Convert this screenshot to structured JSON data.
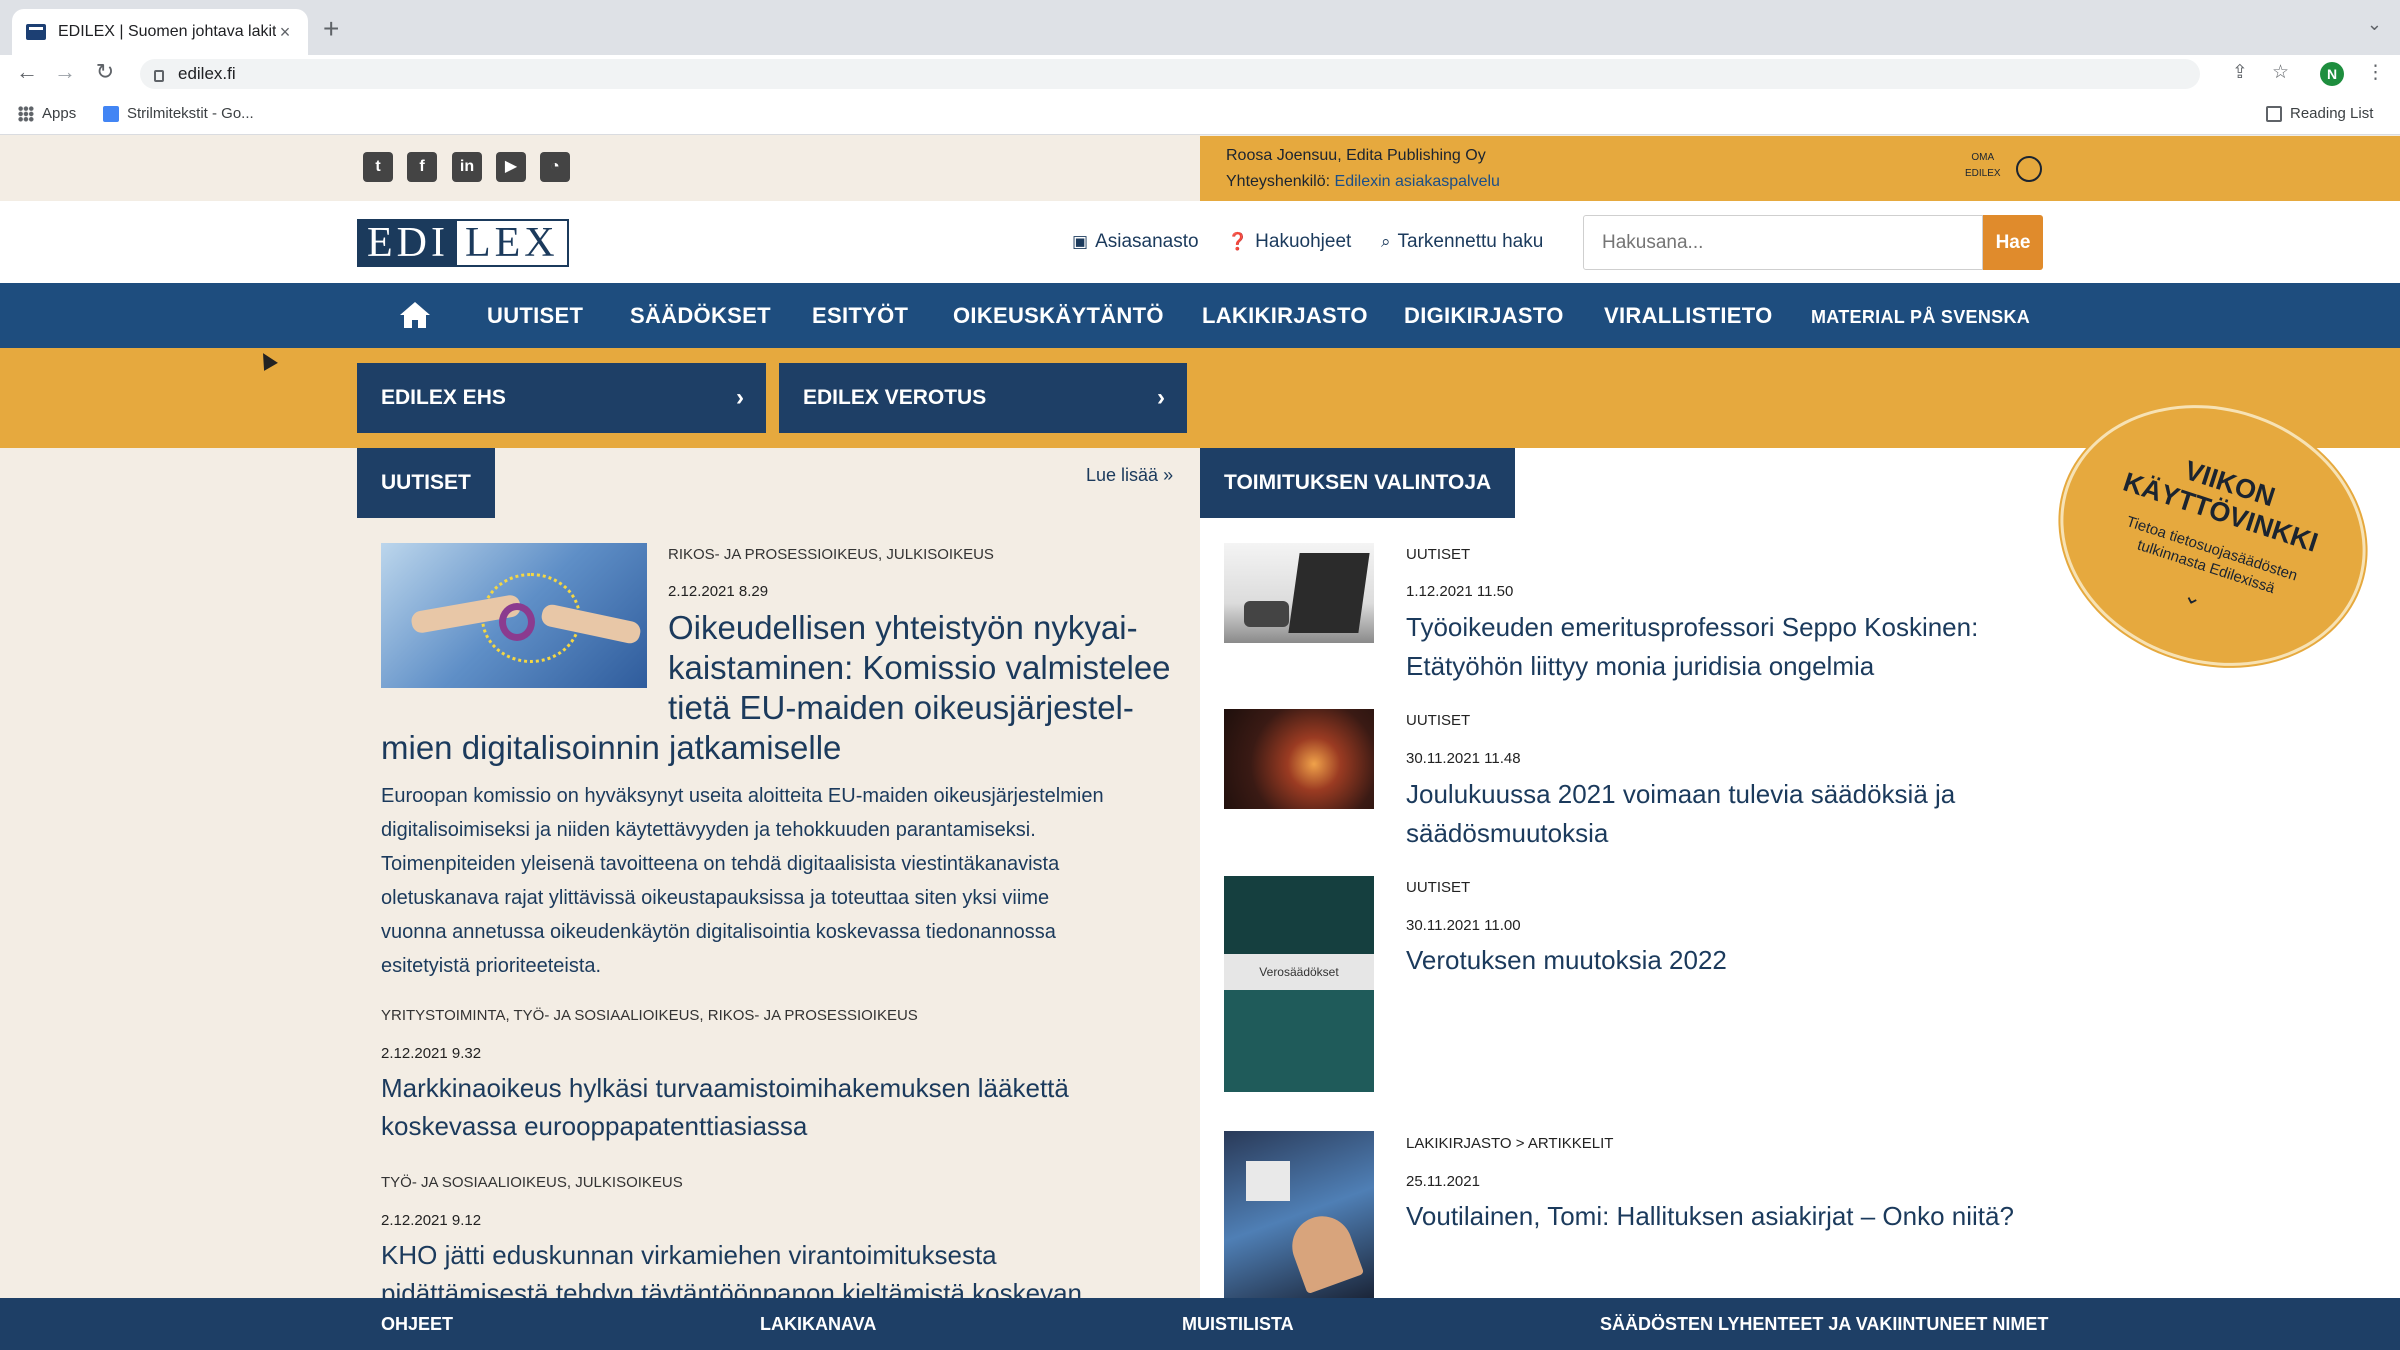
{
  "browser": {
    "tab_title": "EDILEX | Suomen johtava lakit",
    "url": "edilex.fi",
    "bookmarks": [
      "Apps",
      "Strilmitekstit - Go..."
    ],
    "reading_list": "Reading List",
    "profile_initial": "N"
  },
  "userbar": {
    "name": "Roosa Joensuu, Edita Publishing Oy",
    "contact_label": "Yhteyshenkilö:",
    "contact_link": "Edilexin asiakaspalvelu",
    "oma_line1": "OMA",
    "oma_line2": "EDILEX"
  },
  "logo": {
    "part1": "EDI",
    "part2": "LEX"
  },
  "header_links": [
    "Asiasanasto",
    "Hakuohjeet",
    "Tarkennettu haku"
  ],
  "search": {
    "placeholder": "Hakusana...",
    "button": "Hae"
  },
  "nav": [
    "UUTISET",
    "SÄÄDÖKSET",
    "ESITYÖT",
    "OIKEUSKÄYTÄNTÖ",
    "LAKIKIRJASTO",
    "DIGIKIRJASTO",
    "VIRALLISTIETO",
    "MATERIAL PÅ SVENSKA"
  ],
  "quick": [
    "EDILEX EHS",
    "EDILEX VEROTUS"
  ],
  "news": {
    "section": "UUTISET",
    "read_more": "Lue lisää",
    "featured": {
      "categories": "RIKOS- JA PROSESSIOIKEUS, JULKISOIKEUS",
      "date": "2.12.2021 8.29",
      "title_l1": "Oikeudellisen yhteistyön nykyai-",
      "title_l2": "kaistaminen: Komissio valmistelee",
      "title_l3": "tietä EU-maiden oikeusjärjestel-",
      "title_l4": "mien digitalisoinnin jatkamiselle",
      "body_l1": "Euroopan komissio on hyväksynyt useita aloitteita EU-maiden oikeusjärjestelmien",
      "body_l2": "digitalisoimiseksi ja niiden käytettävyyden ja tehokkuuden parantamiseksi.",
      "body_l3": "Toimenpiteiden yleisenä tavoitteena on tehdä digitaalisista viestintäkanavista",
      "body_l4": "oletuskanava rajat ylittävissä oikeustapauksissa ja toteuttaa siten yksi viime",
      "body_l5": "vuonna annetussa oikeudenkäytön digitalisointia koskevassa tiedonannossa",
      "body_l6": "esitetyistä prioriteeteista."
    },
    "item2": {
      "categories": "YRITYSTOIMINTA, TYÖ- JA SOSIAALIOIKEUS, RIKOS- JA PROSESSIOIKEUS",
      "date": "2.12.2021 9.32",
      "title_l1": "Markkinaoikeus hylkäsi turvaamistoimihakemuksen lääkettä",
      "title_l2": "koskevassa eurooppapatenttiasiassa"
    },
    "item3": {
      "categories": "TYÖ- JA SOSIAALIOIKEUS, JULKISOIKEUS",
      "date": "2.12.2021 9.12",
      "title_l1": "KHO jätti eduskunnan virkamiehen virantoimituksesta",
      "title_l2": "pidättämisestä tehdyn täytäntöönpanon kieltämistä koskevan"
    }
  },
  "editors": {
    "section": "TOIMITUKSEN VALINTOJA",
    "items": [
      {
        "category": "UUTISET",
        "date": "1.12.2021 11.50",
        "title_l1": "Työoikeuden emeritusprofessori Seppo Koskinen:",
        "title_l2": "Etätyöhön liittyy monia juridisia ongelmia"
      },
      {
        "category": "UUTISET",
        "date": "30.11.2021 11.48",
        "title_l1": "Joulukuussa 2021 voimaan tulevia säädöksiä ja",
        "title_l2": "säädösmuutoksia"
      },
      {
        "category": "UUTISET",
        "date": "30.11.2021 11.00",
        "title_l1": "Verotuksen muutoksia 2022",
        "title_l2": ""
      },
      {
        "category": "LAKIKIRJASTO > ARTIKKELIT",
        "date": "25.11.2021",
        "title_l1": "Voutilainen, Tomi: Hallituksen asiakirjat – Onko niitä?",
        "title_l2": ""
      }
    ],
    "book_label": "Verosäädökset"
  },
  "badge": {
    "line1": "VIIKON",
    "line2": "KÄYTTÖVINKKI",
    "line3": "Tietoa tietosuojasäädösten",
    "line4": "tulkinnasta Edilexissä"
  },
  "footer": [
    "OHJEET",
    "LAKIKANAVA",
    "MUISTILISTA",
    "SÄÄDÖSTEN LYHENTEET JA VAKIINTUNEET NIMET"
  ],
  "colors": {
    "navy": "#1e4d7e",
    "dark_navy": "#1e3f66",
    "orange": "#e6a93e",
    "search_button": "#e08b2c",
    "page_bg": "#f3ede4"
  }
}
